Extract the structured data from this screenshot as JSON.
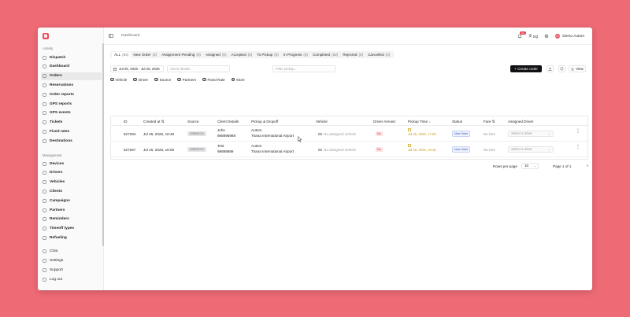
{
  "breadcrumb": "Dashboard",
  "header": {
    "notification_count": "10+",
    "language": "SQ",
    "user_initials": "DA",
    "user_name": "Demo Autom"
  },
  "sidebar": {
    "activity_label": "Activity",
    "management_label": "Management",
    "activity_items": [
      {
        "label": "Dispatch",
        "icon": "dispatch-icon"
      },
      {
        "label": "Dashboard",
        "icon": "dashboard-icon"
      },
      {
        "label": "Orders",
        "icon": "orders-icon",
        "active": true
      },
      {
        "label": "Reservations",
        "icon": "reservations-icon"
      },
      {
        "label": "Order reports",
        "icon": "report-icon"
      },
      {
        "label": "GPS reports",
        "icon": "gps-icon"
      },
      {
        "label": "GPS events",
        "icon": "gps-event-icon"
      },
      {
        "label": "Tickets",
        "icon": "ticket-icon"
      },
      {
        "label": "Fixed rates",
        "icon": "rate-icon"
      },
      {
        "label": "Destinations",
        "icon": "destination-icon"
      }
    ],
    "management_items": [
      {
        "label": "Devices",
        "icon": "device-icon"
      },
      {
        "label": "Drivers",
        "icon": "driver-icon"
      },
      {
        "label": "Vehicles",
        "icon": "vehicle-icon"
      },
      {
        "label": "Clients",
        "icon": "client-icon"
      },
      {
        "label": "Campaigns",
        "icon": "campaign-icon"
      },
      {
        "label": "Partners",
        "icon": "partner-icon"
      },
      {
        "label": "Reminders",
        "icon": "reminder-icon"
      },
      {
        "label": "Timeoff types",
        "icon": "timeoff-icon"
      },
      {
        "label": "Refueling",
        "icon": "fuel-icon"
      }
    ],
    "bottom_items": [
      {
        "label": "Chat",
        "icon": "chat-icon"
      },
      {
        "label": "Settings",
        "icon": "gear-icon"
      },
      {
        "label": "Support",
        "icon": "support-icon"
      },
      {
        "label": "Log out",
        "icon": "logout-icon"
      }
    ]
  },
  "status_tabs": [
    {
      "label": "ALL",
      "count": "(64)",
      "active": true
    },
    {
      "label": "New Order",
      "count": "(2)"
    },
    {
      "label": "Assignment Pending",
      "count": "(0)"
    },
    {
      "label": "Assigned",
      "count": "(0)"
    },
    {
      "label": "Accepted",
      "count": "(0)"
    },
    {
      "label": "To Pickup",
      "count": "(0)"
    },
    {
      "label": "In Progress",
      "count": "(0)"
    },
    {
      "label": "Completed",
      "count": "(62)"
    },
    {
      "label": "Rejected",
      "count": "(0)"
    },
    {
      "label": "Cancelled",
      "count": "(0)"
    }
  ],
  "filters": {
    "date_range": "Jul 25, 2026 - Jul 25, 2026",
    "client_placeholder": "Client details...",
    "pickup_placeholder": "Filter pickup...",
    "create_label": "+ Create order",
    "view_label": "View"
  },
  "filter_chips": [
    "Vehicle",
    "Driver",
    "Source",
    "Partners",
    "Fixed Rate",
    "More"
  ],
  "table": {
    "columns": [
      "ID",
      "Created at",
      "Source",
      "Client Details",
      "Pickup & Dropoff",
      "Vehicle",
      "Driver Arrived",
      "Pickup Time",
      "Status",
      "Fare",
      "Assigned Driver"
    ],
    "rows": [
      {
        "id": "527294",
        "created_at": "Jul 25, 2026, 16:48",
        "source": "DISPATCH",
        "client_name": "John",
        "client_phone": "988898988",
        "pickup": "Autom",
        "dropoff": "Tirana International Airport",
        "vehicle": "No assigned vehicle",
        "driver_arrived": "No",
        "pickup_time": "Jul 25, 2026, 17:00",
        "status": "New Order",
        "fare": "No fare",
        "assigned_driver": "Select a driver"
      },
      {
        "id": "527267",
        "created_at": "Jul 25, 2026, 16:06",
        "source": "DISPATCH",
        "client_name": "Test",
        "client_phone": "98889889",
        "pickup": "Autom",
        "dropoff": "Tirana International Airport",
        "vehicle": "No assigned vehicle",
        "driver_arrived": "No",
        "pickup_time": "Jul 25, 2026, 16:15",
        "status": "New Order",
        "fare": "No fare",
        "assigned_driver": "Select a driver"
      }
    ]
  },
  "pagination": {
    "rows_label": "Rows per page",
    "rows_value": "10",
    "page_label": "Page 1 of 1"
  }
}
